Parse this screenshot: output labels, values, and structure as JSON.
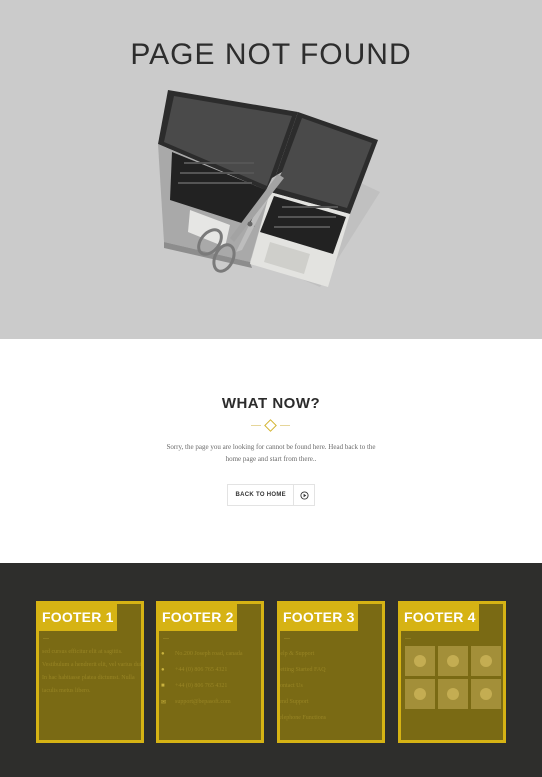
{
  "hero": {
    "title": "PAGE NOT FOUND",
    "illustration": "laptop-cut-by-scissors"
  },
  "main": {
    "heading": "WHAT NOW?",
    "message": "Sorry, the page you are looking for cannot be found here. Head back to the home page and start from there..",
    "button_label": "BACK TO HOME",
    "button_icon": "arrow-circle-right-icon"
  },
  "footer": {
    "colors": {
      "background": "#2e2e2c",
      "accent": "#d6b314",
      "panel": "#7a6a14"
    },
    "col1": {
      "title": "FOOTER 1",
      "text": "sed cursus efficitur elit at sagittis. Vestibulum a hendrerit elit, vel varius dui. In hac habitasse platea dictumst. Nulla iaculis metus libero."
    },
    "col2": {
      "title": "FOOTER 2",
      "items": [
        {
          "icon": "map-pin-icon",
          "text": "No.200 Joseph road, canada"
        },
        {
          "icon": "phone-icon",
          "text": "+44 (0) 806 765 4321"
        },
        {
          "icon": "mobile-icon",
          "text": "+44 (0) 806 765 4321"
        },
        {
          "icon": "email-icon",
          "text": "support@bepasoft.com"
        }
      ]
    },
    "col3": {
      "title": "FOOTER 3",
      "links": [
        "Help & Support",
        "Getting Started FAQ",
        "Contact Us",
        "Send Support",
        "Telephone Functions"
      ]
    },
    "col4": {
      "title": "FOOTER 4",
      "gallery_count": 6
    }
  }
}
